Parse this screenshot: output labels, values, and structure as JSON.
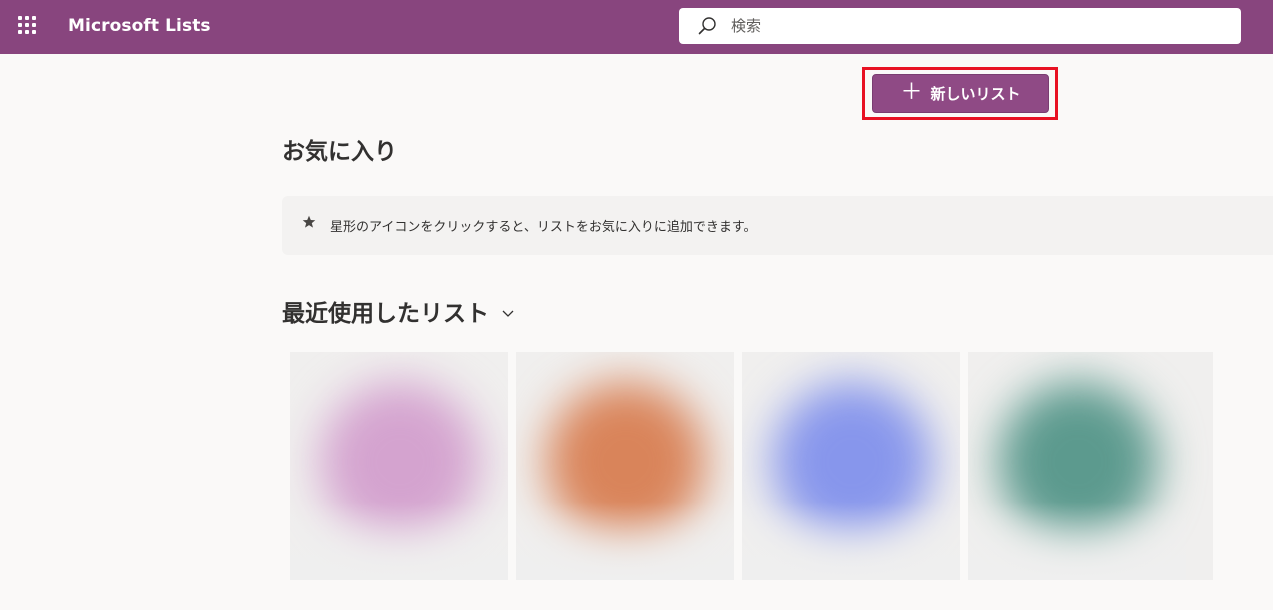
{
  "header": {
    "app_title": "Microsoft Lists",
    "search_placeholder": "検索",
    "accent_color": "#88457e"
  },
  "toolbar": {
    "new_list_label": "新しいリスト",
    "new_list_plus": "＋"
  },
  "favorites": {
    "heading": "お気に入り",
    "empty_message": "星形のアイコンをクリックすると、リストをお気に入りに追加できます。"
  },
  "recent": {
    "heading": "最近使用したリスト",
    "cards": [
      {
        "color": "#d4a3cf"
      },
      {
        "color": "#d9845a"
      },
      {
        "color": "#8796ec"
      },
      {
        "color": "#5c9a8e"
      }
    ]
  }
}
